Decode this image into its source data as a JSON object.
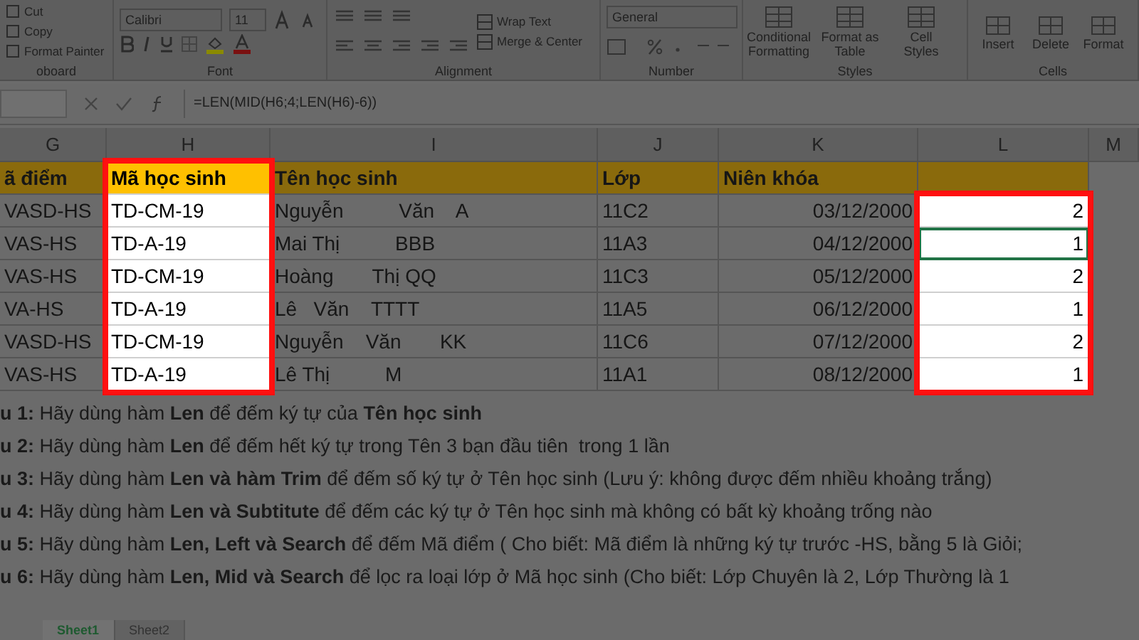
{
  "ribbon": {
    "groups": [
      {
        "kind": "clipboard",
        "label": "oboard",
        "items": [
          "Cut",
          "Copy",
          "Format Painter"
        ]
      },
      {
        "kind": "font",
        "label": "Font",
        "font_name": "Calibri",
        "font_size": "11"
      },
      {
        "kind": "alignment",
        "label": "Alignment",
        "items": [
          "Wrap Text",
          "Merge & Center"
        ]
      },
      {
        "kind": "number",
        "label": "Number",
        "format": "General"
      },
      {
        "kind": "styles",
        "label": "Styles",
        "items": [
          "Conditional Formatting",
          "Format as Table",
          "Cell Styles"
        ]
      },
      {
        "kind": "cells",
        "label": "Cells",
        "items": [
          "Insert",
          "Delete",
          "Format"
        ]
      }
    ]
  },
  "formula_bar": {
    "formula": "=LEN(MID(H6;4;LEN(H6)-6))"
  },
  "sheet": {
    "columns": [
      {
        "letter": "G",
        "framed": false
      },
      {
        "letter": "H",
        "framed": true
      },
      {
        "letter": "I",
        "framed": false
      },
      {
        "letter": "J",
        "framed": false
      },
      {
        "letter": "K",
        "framed": false
      },
      {
        "letter": "L",
        "framed": true
      },
      {
        "letter": "M",
        "framed": false
      }
    ],
    "header_row": [
      {
        "text": "ã điểm",
        "highlighted": false
      },
      {
        "text": "Mã học sinh",
        "highlighted": true
      },
      {
        "text": "Tên học sinh",
        "highlighted": false
      },
      {
        "text": "Lớp",
        "highlighted": false
      },
      {
        "text": "Niên khóa",
        "highlighted": false
      },
      {
        "highlighted": false
      }
    ],
    "rows": [
      {
        "cells": [
          "VASD-HS",
          "TD-CM-19",
          "Nguyễn          Văn    A",
          "11C2",
          "03/12/2000"
        ],
        "result": {
          "text": "2",
          "selected": false
        }
      },
      {
        "cells": [
          "VAS-HS",
          "TD-A-19",
          "Mai Thị          BBB",
          "11A3",
          "04/12/2000"
        ],
        "result": {
          "text": "1",
          "selected": true
        }
      },
      {
        "cells": [
          "VAS-HS",
          "TD-CM-19",
          "Hoàng       Thị QQ",
          "11C3",
          "05/12/2000"
        ],
        "result": {
          "text": "2",
          "selected": false
        }
      },
      {
        "cells": [
          "VA-HS",
          "TD-A-19",
          "Lê   Văn    TTTT",
          "11A5",
          "06/12/2000"
        ],
        "result": {
          "text": "1",
          "selected": false
        }
      },
      {
        "cells": [
          "VASD-HS",
          "TD-CM-19",
          "Nguyễn    Văn       KK",
          "11C6",
          "07/12/2000"
        ],
        "result": {
          "text": "2",
          "selected": false
        }
      },
      {
        "cells": [
          "VAS-HS",
          "TD-A-19",
          "Lê Thị          M",
          "11A1",
          "08/12/2000"
        ],
        "result": {
          "text": "1",
          "selected": false
        }
      }
    ],
    "notes": [
      "**u 1:** Hãy dùng hàm **Len** để đếm ký tự của **Tên học sinh**",
      "**u 2:** Hãy dùng hàm **Len** để đếm hết ký tự trong Tên 3 bạn đầu tiên  trong 1 lần",
      "**u 3:** Hãy dùng hàm **Len và hàm Trim** để đếm số ký tự ở Tên học sinh (Lưu ý: không được đếm nhiều khoảng trắng)",
      "**u 4:** Hãy dùng hàm **Len và Subtitute** để đếm các ký tự ở Tên học sinh mà không có bất kỳ khoảng trống nào",
      "**u 5:** Hãy dùng hàm **Len, Left và Search** để đếm Mã điểm ( Cho biết: Mã điểm là những ký tự trước -HS, bằng 5 là Giỏi;",
      "**u 6:** Hãy dùng hàm **Len, Mid và Search** để lọc ra loại lớp ở Mã học sinh (Cho biết: Lớp Chuyên là 2, Lớp Thường là 1"
    ]
  },
  "sheet_tabs": [
    {
      "label": "Sheet1",
      "selected": true
    },
    {
      "label": "Sheet2",
      "selected": false
    }
  ]
}
